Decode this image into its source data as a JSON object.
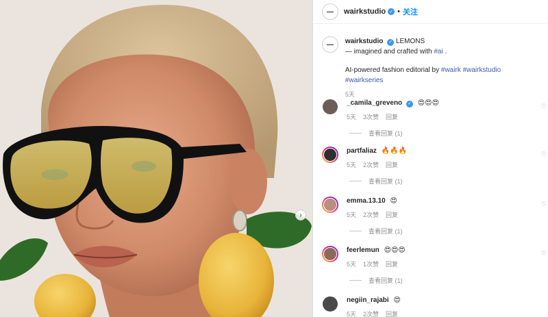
{
  "header": {
    "username": "wairkstudio",
    "dot": "•",
    "follow_label": "关注"
  },
  "caption": {
    "username": "wairkstudio",
    "title": "LEMONS",
    "line2_prefix": "— imagined and crafted with ",
    "line2_tag": "#ai",
    "line2_suffix": " .",
    "line3_prefix": "AI-powered fashion editorial by ",
    "tags": [
      "#wairk",
      "#wairkstudio",
      "#wairkseries"
    ],
    "time": "5天"
  },
  "comments": [
    {
      "name": "_camila_greveno",
      "verified": true,
      "text": "😍😍😍",
      "time": "5天",
      "likes": "3次赞",
      "reply": "回复",
      "view_replies": "查看回复 (1)",
      "avatar_color": "#6d5d58",
      "ring": false
    },
    {
      "name": "partfaliaz",
      "verified": false,
      "text": "🔥🔥🔥",
      "time": "5天",
      "likes": "2次赞",
      "reply": "回复",
      "view_replies": "查看回复 (1)",
      "avatar_color": "#2f2f2f",
      "ring": true
    },
    {
      "name": "emma.13.10",
      "verified": false,
      "text": "😍",
      "time": "5天",
      "likes": "2次赞",
      "reply": "回复",
      "view_replies": "查看回复 (1)",
      "avatar_color": "#b88e7f",
      "ring": true
    },
    {
      "name": "feerlemun",
      "verified": false,
      "text": "😍😍😍",
      "time": "5天",
      "likes": "1次赞",
      "reply": "回复",
      "view_replies": "查看回复 (1)",
      "avatar_color": "#8c6a5b",
      "ring": true
    },
    {
      "name": "negiin_rajabi",
      "verified": false,
      "text": "😍",
      "time": "5天",
      "likes": "2次赞",
      "reply": "回复",
      "view_replies": "",
      "avatar_color": "#4a4a4a",
      "ring": false
    }
  ],
  "colors": {
    "accent": "#0095f6",
    "hashtag": "#3d5aa8",
    "verified": "#3897f0",
    "muted": "#8e8e8e"
  }
}
